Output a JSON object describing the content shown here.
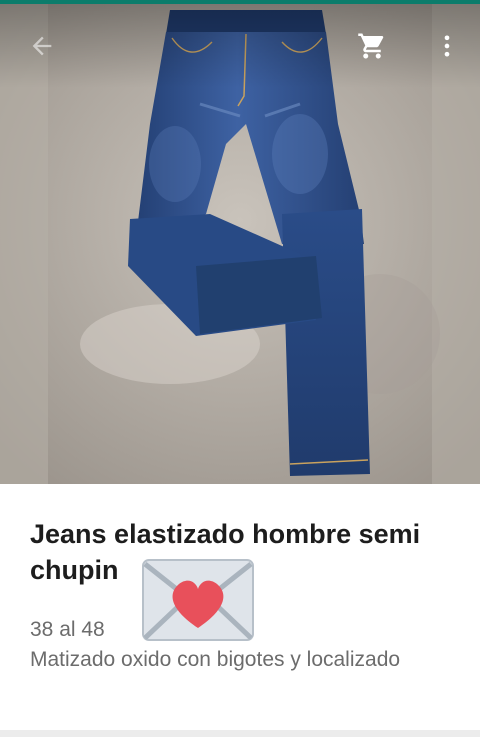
{
  "product": {
    "title": "Jeans elastizado hombre semi chupin",
    "size_range": "38 al 48",
    "description": "Matizado oxido con bigotes y localizado"
  },
  "toolbar": {
    "back_icon": "arrow-back-icon",
    "cart_icon": "shopping-cart-icon",
    "more_icon": "more-vert-icon"
  },
  "colors": {
    "status_bar": "#0b7c6b",
    "denim": "#2b4f8c",
    "title_text": "#1d1d1d",
    "secondary_text": "#6c6c6c",
    "heart": "#e8505b"
  }
}
